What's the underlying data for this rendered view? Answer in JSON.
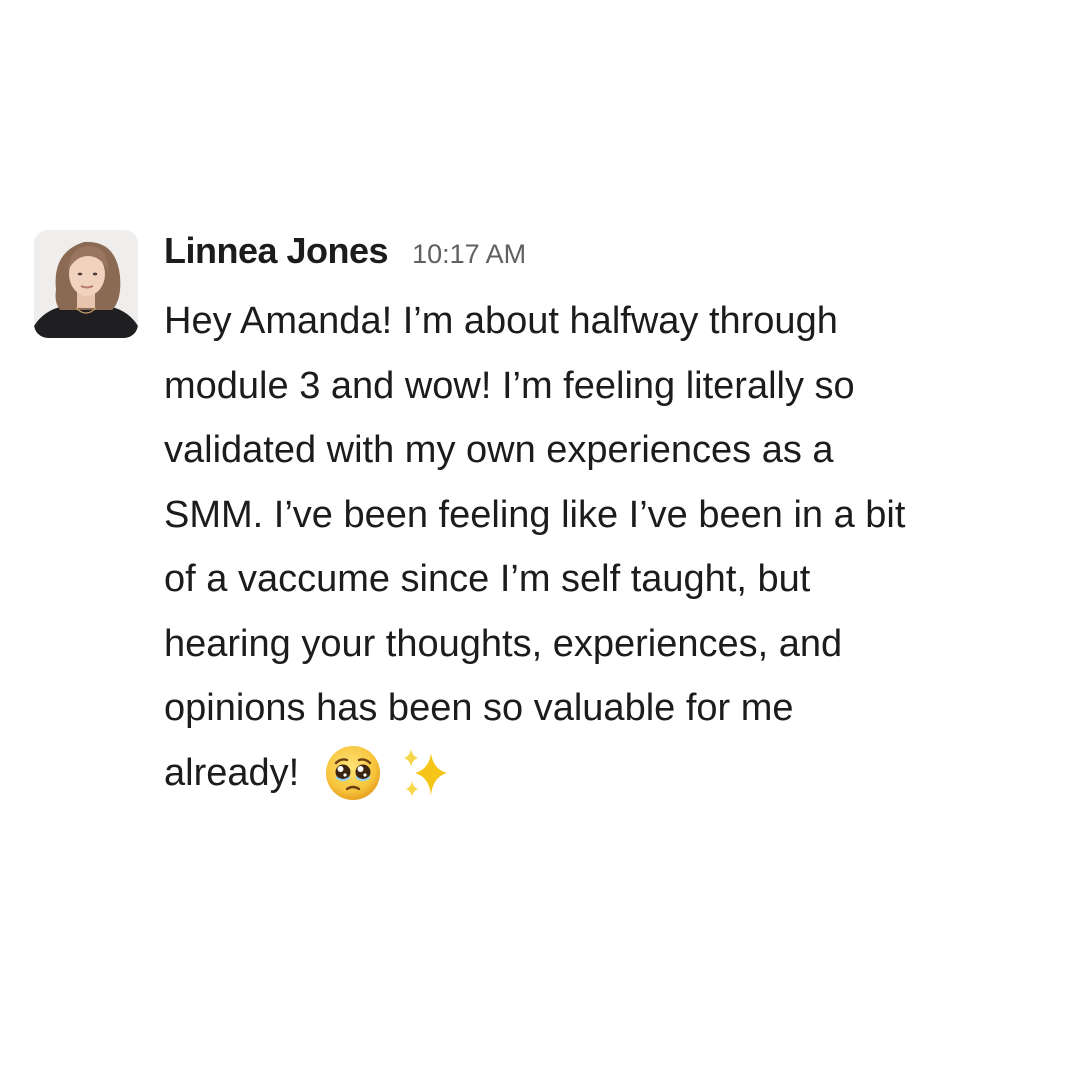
{
  "message": {
    "author": "Linnea Jones",
    "timestamp": "10:17 AM",
    "avatar": "user-avatar-photo",
    "lines": [
      "Hey Amanda! I’m about halfway through",
      "module 3 and wow! I’m feeling literally so",
      "validated with my own experiences as a",
      "SMM. I’ve been feeling like I’ve been in a bit",
      "of a vaccume since I’m self taught, but",
      "hearing your thoughts, experiences, and",
      "opinions has been so valuable for me",
      "already!"
    ],
    "emojis": [
      "pleading-face-emoji",
      "sparkles-emoji"
    ]
  },
  "colors": {
    "background": "#ffffff",
    "text": "#1d1c1d",
    "timestamp": "#616061",
    "emoji_face": "#f7c53c",
    "sparkles": "#f5c518"
  }
}
